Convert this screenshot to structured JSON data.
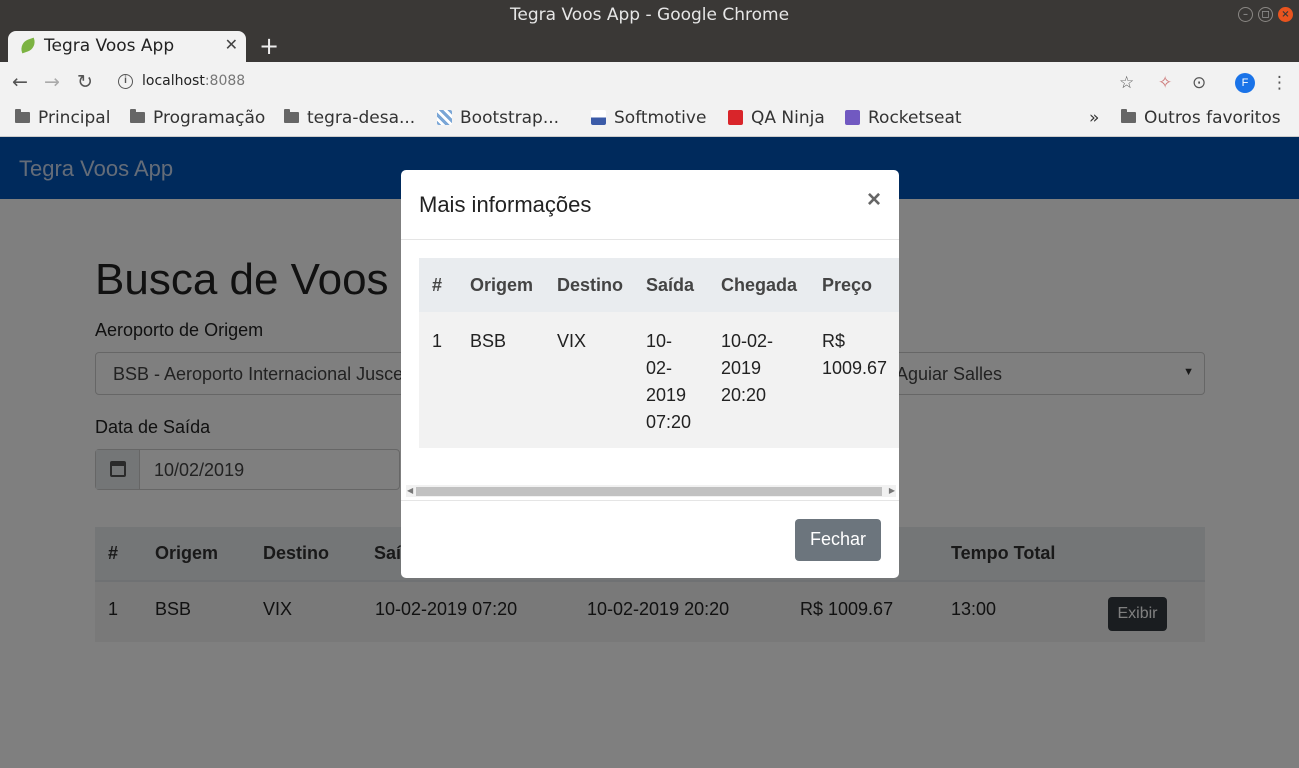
{
  "window": {
    "title": "Tegra Voos App - Google Chrome"
  },
  "browser": {
    "tab_title": "Tegra Voos App",
    "url_host": "localhost",
    "url_port": ":8088",
    "profile_initial": "F",
    "bookmarks": [
      {
        "label": "Principal",
        "icon": "folder-icon"
      },
      {
        "label": "Programação",
        "icon": "folder-icon"
      },
      {
        "label": "tegra-desa...",
        "icon": "folder-icon"
      },
      {
        "label": "Bootstrap...",
        "icon": "bootstrap-favicon"
      },
      {
        "label": "Softmotive",
        "icon": "softmotive-favicon"
      },
      {
        "label": "QA Ninja",
        "icon": "qaninja-favicon"
      },
      {
        "label": "Rocketseat",
        "icon": "rocketseat-favicon"
      }
    ],
    "overflow_label": "»",
    "other_bookmarks": "Outros favoritos"
  },
  "app": {
    "brand": "Tegra Voos App",
    "page_title": "Busca de Voos",
    "origin_label": "Aeroporto de Origem",
    "origin_value": "BSB - Aeroporto Internacional Jusce",
    "origin_value_right": "Aguiar Salles",
    "date_label": "Data de Saída",
    "date_value": "10/02/2019",
    "results": {
      "headers": [
        "#",
        "Origem",
        "Destino",
        "Saí",
        "Tempo Total"
      ],
      "rows": [
        {
          "num": "1",
          "origem": "BSB",
          "destino": "VIX",
          "saida": "10-02-2019 07:20",
          "chegada": "10-02-2019 20:20",
          "preco": "R$ 1009.67",
          "tempo": "13:00",
          "action": "Exibir"
        }
      ]
    }
  },
  "modal": {
    "title": "Mais informações",
    "close_symbol": "×",
    "headers": [
      "#",
      "Origem",
      "Destino",
      "Saída",
      "Chegada",
      "Preço"
    ],
    "row": {
      "num": "1",
      "origem": "BSB",
      "destino": "VIX",
      "saida": [
        "10-",
        "02-",
        "2019",
        "07:20"
      ],
      "chegada": [
        "10-02-",
        "2019",
        "20:20"
      ],
      "preco": [
        "R$",
        "1009.67"
      ]
    },
    "close_button": "Fechar"
  },
  "colors": {
    "navbar": "#0055b8",
    "modal_button": "#6c757d",
    "exibir_button": "#343a40"
  }
}
